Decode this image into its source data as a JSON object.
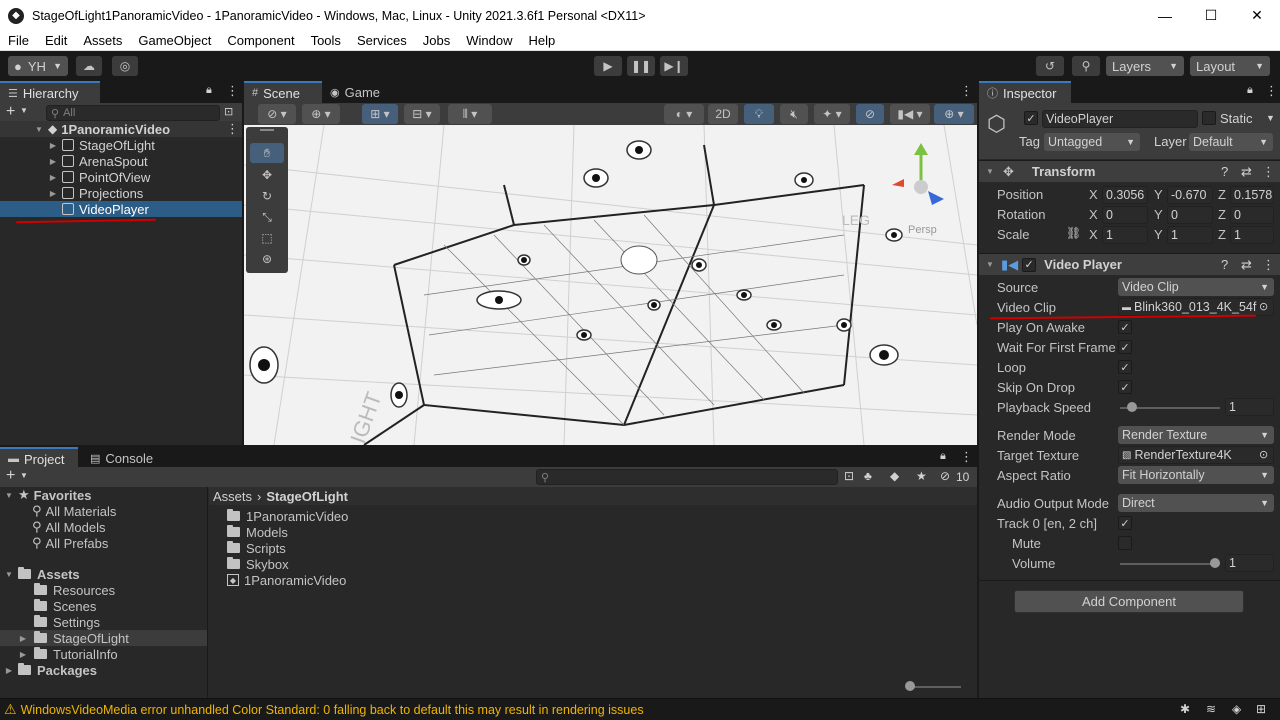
{
  "window": {
    "title": "StageOfLight1PanoramicVideo - 1PanoramicVideo - Windows, Mac, Linux - Unity 2021.3.6f1 Personal <DX11>",
    "minimize": "—",
    "maximize": "☐",
    "close": "✕"
  },
  "menu": [
    "File",
    "Edit",
    "Assets",
    "GameObject",
    "Component",
    "Tools",
    "Services",
    "Jobs",
    "Window",
    "Help"
  ],
  "toolbar": {
    "account": "YH",
    "layers": "Layers",
    "layout": "Layout"
  },
  "hierarchy": {
    "tab": "Hierarchy",
    "search_placeholder": "All",
    "scene": "1PanoramicVideo",
    "items": [
      "StageOfLight",
      "ArenaSpout",
      "PointOfView",
      "Projections",
      "VideoPlayer"
    ]
  },
  "scene_tabs": [
    "Scene",
    "Game"
  ],
  "scene_toolbar": {
    "mode_2d": "2D"
  },
  "scene_overlay": {
    "persp": "Persp",
    "wall_text": "LEG",
    "floor_text": "IGHT"
  },
  "inspector": {
    "tab": "Inspector",
    "object_name": "VideoPlayer",
    "static_label": "Static",
    "tag_label": "Tag",
    "tag_value": "Untagged",
    "layer_label": "Layer",
    "layer_value": "Default",
    "transform": {
      "title": "Transform",
      "position_label": "Position",
      "rotation_label": "Rotation",
      "scale_label": "Scale",
      "position": [
        "0.3056",
        "-0.670",
        "0.1578"
      ],
      "rotation": [
        "0",
        "0",
        "0"
      ],
      "scale": [
        "1",
        "1",
        "1"
      ],
      "axes": [
        "X",
        "Y",
        "Z"
      ]
    },
    "video_player": {
      "title": "Video Player",
      "source_label": "Source",
      "source_value": "Video Clip",
      "clip_label": "Video Clip",
      "clip_value": "Blink360_013_4K_54f",
      "play_on_awake": "Play On Awake",
      "wait_first_frame": "Wait For First Frame",
      "loop": "Loop",
      "skip_on_drop": "Skip On Drop",
      "playback_speed": "Playback Speed",
      "playback_speed_value": "1",
      "render_mode_label": "Render Mode",
      "render_mode_value": "Render Texture",
      "target_texture_label": "Target Texture",
      "target_texture_value": "RenderTexture4K",
      "aspect_ratio_label": "Aspect Ratio",
      "aspect_ratio_value": "Fit Horizontally",
      "audio_output_label": "Audio Output Mode",
      "audio_output_value": "Direct",
      "track_label": "Track 0 [en, 2 ch]",
      "mute_label": "Mute",
      "volume_label": "Volume",
      "volume_value": "1",
      "checkmark": "✓"
    },
    "add_component": "Add Component"
  },
  "project": {
    "tabs": [
      "Project",
      "Console"
    ],
    "favorites_label": "Favorites",
    "favorites": [
      "All Materials",
      "All Models",
      "All Prefabs"
    ],
    "assets_label": "Assets",
    "asset_folders": [
      "Resources",
      "Scenes",
      "Settings",
      "StageOfLight",
      "TutorialInfo"
    ],
    "packages_label": "Packages",
    "breadcrumb": [
      "Assets",
      "StageOfLight"
    ],
    "contents": [
      "1PanoramicVideo",
      "Models",
      "Scripts",
      "Skybox",
      "1PanoramicVideo"
    ],
    "hidden_count": "10"
  },
  "status": {
    "message": "WindowsVideoMedia error unhandled Color Standard: 0  falling back to default this may result in rendering issues"
  }
}
